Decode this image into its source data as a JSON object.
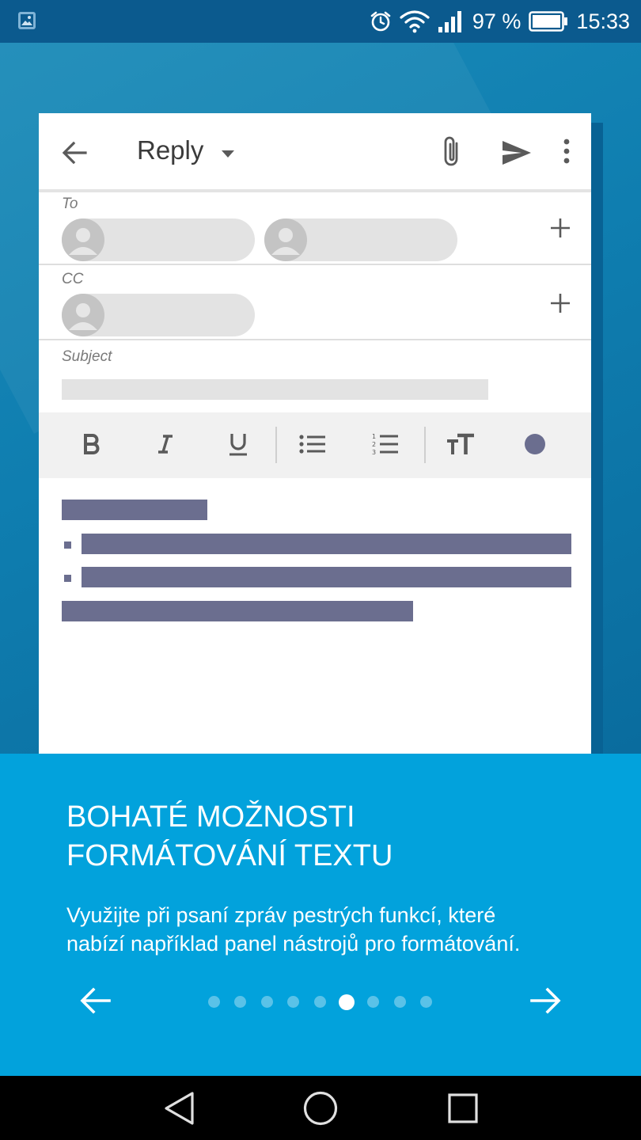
{
  "status_bar": {
    "battery_percent": "97 %",
    "time": "15:33",
    "icons": [
      "image-notification-icon",
      "alarm-icon",
      "wifi-icon",
      "signal-icon",
      "battery-icon"
    ]
  },
  "compose": {
    "title": "Reply",
    "fields": {
      "to_label": "To",
      "cc_label": "CC",
      "subject_label": "Subject"
    },
    "toolbar_icons": [
      "back-arrow-icon",
      "dropdown-caret-icon",
      "attach-icon",
      "send-icon",
      "more-vert-icon"
    ],
    "format_icons": [
      "bold-icon",
      "italic-icon",
      "underline-icon",
      "bulleted-list-icon",
      "numbered-list-icon",
      "text-size-icon",
      "text-color-icon"
    ]
  },
  "onboarding": {
    "title_line1": "BOHATÉ MOŽNOSTI",
    "title_line2": "FORMÁTOVÁNÍ TEXTU",
    "description": "Využijte při psaní zpráv pestrých funkcí, které nabízí například panel nástrojů pro formátování.",
    "page_count": 9,
    "current_page": 6
  },
  "colors": {
    "status_bar": "#0b5a8e",
    "panel": "#02a2dc",
    "placeholder_text": "#6b6e8f",
    "navbar": "#000000"
  }
}
